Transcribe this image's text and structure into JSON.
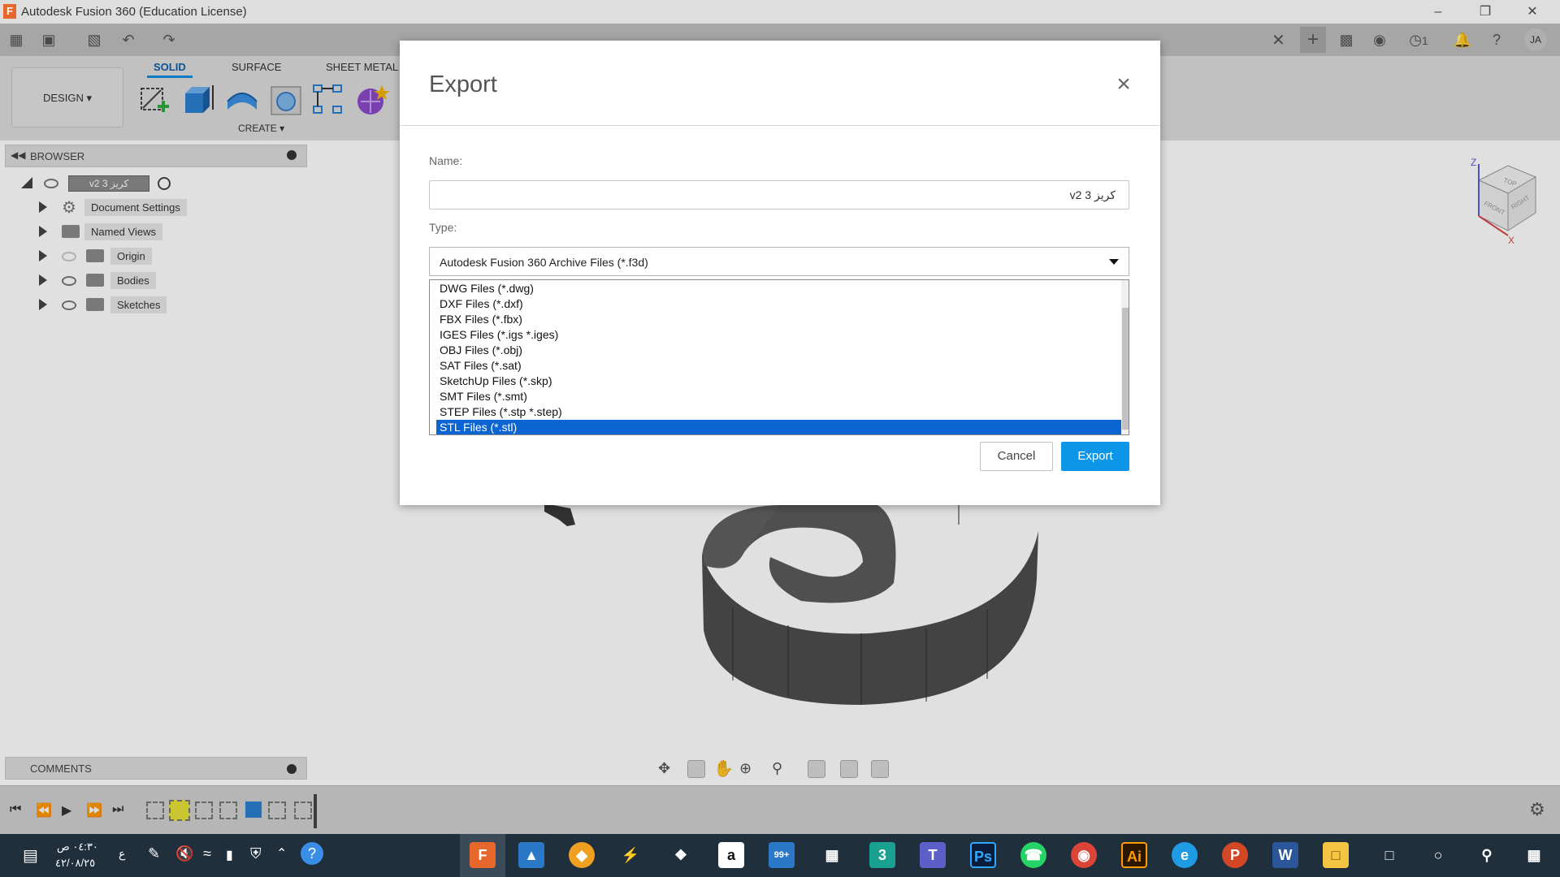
{
  "titlebar": {
    "app_icon": "F",
    "title": "Autodesk Fusion 360 (Education License)"
  },
  "qat": {
    "icons": [
      "grid-icon",
      "file-icon",
      "save-icon",
      "undo-icon",
      "redo-icon"
    ],
    "right_icons": [
      "close-tab-icon",
      "plus-icon",
      "chat-icon",
      "extensions-icon",
      "job-status-icon",
      "notification-icon",
      "help-icon",
      "avatar"
    ],
    "job_count": "1",
    "avatar_initials": "JA"
  },
  "ribbon": {
    "workspace": "DESIGN",
    "tabs": [
      "SOLID",
      "SURFACE",
      "SHEET METAL"
    ],
    "active_tab": "SOLID",
    "create_label": "CREATE"
  },
  "browser": {
    "label": "BROWSER",
    "root_label": "كريز 3 v2",
    "items": [
      {
        "label": "Document Settings",
        "icon": "gear-icon"
      },
      {
        "label": "Named Views",
        "icon": "folder-icon"
      },
      {
        "label": "Origin",
        "icon": "folder-icon"
      },
      {
        "label": "Bodies",
        "icon": "folder-icon"
      },
      {
        "label": "Sketches",
        "icon": "folder-icon"
      }
    ]
  },
  "comments": {
    "label": "COMMENTS"
  },
  "dialog": {
    "title": "Export",
    "name_label": "Name:",
    "name_value": "كريز 3 v2",
    "type_label": "Type:",
    "type_value": "Autodesk Fusion 360 Archive Files (*.f3d)",
    "options": [
      "DWG Files (*.dwg)",
      "DXF Files (*.dxf)",
      "FBX Files (*.fbx)",
      "IGES Files (*.igs *.iges)",
      "OBJ Files (*.obj)",
      "SAT Files (*.sat)",
      "SketchUp Files (*.skp)",
      "SMT Files (*.smt)",
      "STEP Files (*.stp *.step)",
      "STL Files (*.stl)"
    ],
    "selected_option": "STL Files (*.stl)",
    "cancel_label": "Cancel",
    "export_label": "Export"
  },
  "viewcube": {
    "top": "TOP",
    "front": "FRONT",
    "right": "RIGHT",
    "axis_x": "X",
    "axis_z": "Z"
  },
  "taskbar": {
    "time": "٠٤:٣٠ ص",
    "date": "٤٢/٠٨/٢٥",
    "lang": "ع",
    "mail_badge": "99+"
  },
  "colors": {
    "accent": "#0d96e8",
    "selection": "#0a64d2",
    "model": "#5a5b5a",
    "taskbar": "#1f2f3c"
  }
}
